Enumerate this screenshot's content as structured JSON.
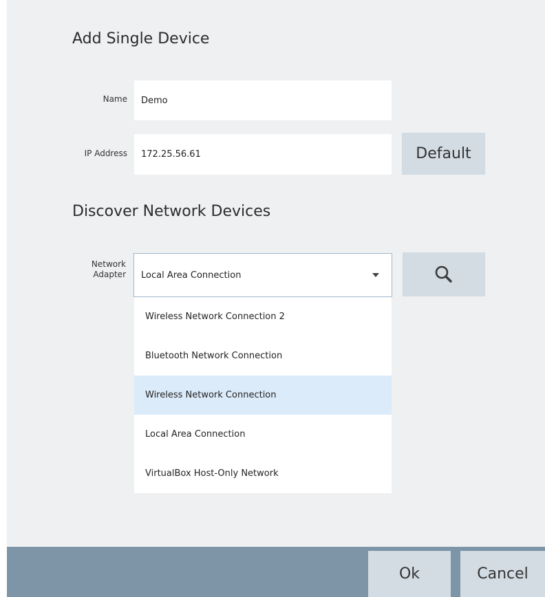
{
  "add_single_device": {
    "title": "Add Single Device",
    "name_label": "Name",
    "name_value": "Demo",
    "ip_label": "IP Address",
    "ip_value": "172.25.56.61",
    "default_button": "Default"
  },
  "discover": {
    "title": "Discover Network Devices",
    "adapter_label_line1": "Network",
    "adapter_label_line2": "Adapter",
    "adapter_selected": "Local Area Connection",
    "search_icon": "search-icon",
    "options": [
      "Wireless Network Connection 2",
      "Bluetooth Network Connection",
      "Wireless Network Connection",
      "Local Area Connection",
      "VirtualBox Host-Only Network"
    ],
    "highlighted_option": "Wireless Network Connection"
  },
  "footer": {
    "ok_label": "Ok",
    "cancel_label": "Cancel"
  },
  "colors": {
    "dialog_background": "#eef0f2",
    "button_background": "#d3dce3",
    "footer_background": "#7e95a7",
    "highlight": "#dcebfa",
    "dropdown_border": "#9fb7cb"
  }
}
